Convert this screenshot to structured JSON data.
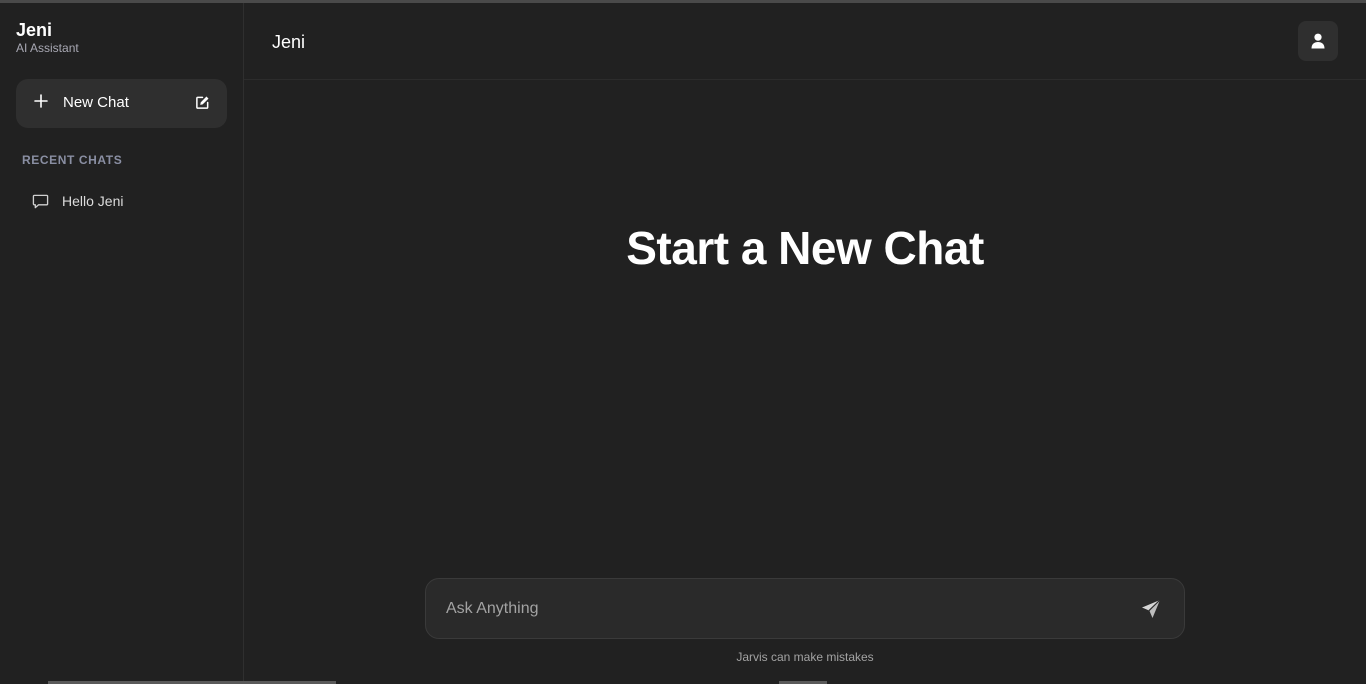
{
  "sidebar": {
    "brand_name": "Jeni",
    "brand_subtitle": "AI Assistant",
    "new_chat_label": "New Chat",
    "section_title": "RECENT CHATS",
    "recent_chats": [
      {
        "label": "Hello Jeni"
      }
    ]
  },
  "header": {
    "title": "Jeni",
    "user_icon": "user-icon"
  },
  "main": {
    "hero_title": "Start a New Chat",
    "input_placeholder": "Ask Anything",
    "input_value": "",
    "footnote": "Jarvis can make mistakes"
  },
  "colors": {
    "background": "#212121",
    "surface": "#2f2f2f",
    "text": "#ffffff",
    "muted": "#a3a3a3"
  }
}
